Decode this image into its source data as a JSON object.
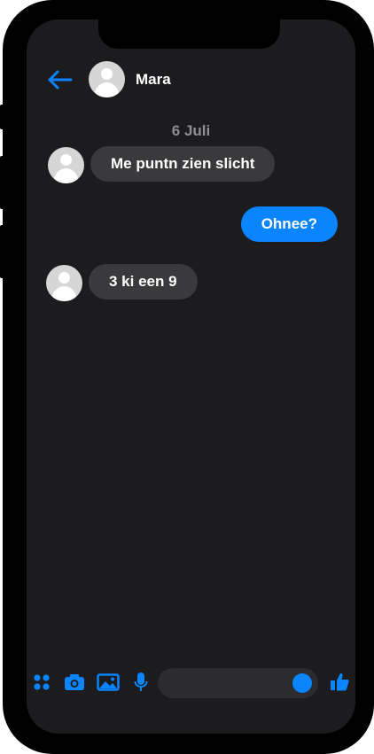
{
  "header": {
    "contact_name": "Mara"
  },
  "conversation": {
    "date_label": "6 Juli",
    "messages": [
      {
        "direction": "incoming",
        "text": "Me puntn zien slicht"
      },
      {
        "direction": "outgoing",
        "text": "Ohnee?"
      },
      {
        "direction": "incoming",
        "text": "3 ki een 9"
      }
    ]
  },
  "composer": {
    "icons": [
      "apps-icon",
      "camera-icon",
      "gallery-icon",
      "microphone-icon",
      "emoji-icon",
      "thumbs-up-icon"
    ]
  },
  "colors": {
    "accent": "#0a84ff",
    "background": "#1c1c1e",
    "incoming_bubble": "#3a3a3c",
    "outgoing_bubble": "#0a84ff"
  }
}
